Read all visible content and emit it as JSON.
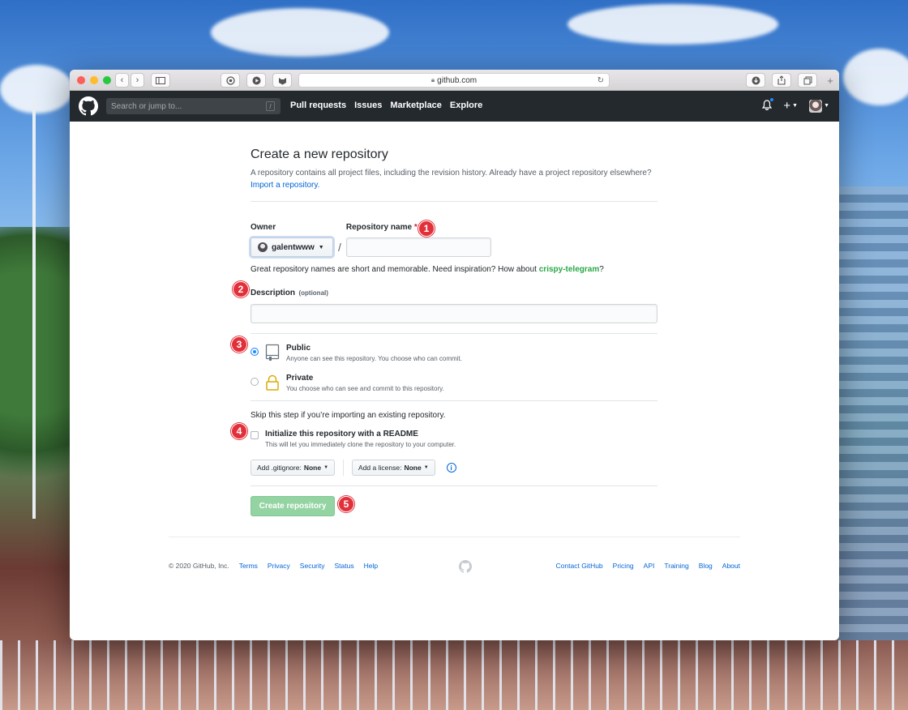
{
  "browser": {
    "url": "github.com"
  },
  "header": {
    "search_placeholder": "Search or jump to...",
    "search_shortcut": "/",
    "nav": [
      "Pull requests",
      "Issues",
      "Marketplace",
      "Explore"
    ],
    "plus_label": "+",
    "has_notification": true
  },
  "page": {
    "title": "Create a new repository",
    "desc_text": "A repository contains all project files, including the revision history. Already have a project repository elsewhere?",
    "import_link": "Import a repository."
  },
  "form": {
    "owner_label": "Owner",
    "owner_value": "galentwww",
    "repo_name_label": "Repository name",
    "required_marker": "*",
    "repo_name_value": "",
    "slash": "/",
    "hint_text": "Great repository names are short and memorable. Need inspiration? How about",
    "hint_suggestion": "crispy-telegram",
    "hint_suffix": "?",
    "description_label": "Description",
    "description_optional": "(optional)",
    "description_value": "",
    "visibility": [
      {
        "title": "Public",
        "desc": "Anyone can see this repository. You choose who can commit.",
        "checked": true
      },
      {
        "title": "Private",
        "desc": "You choose who can see and commit to this repository.",
        "checked": false
      }
    ],
    "skip_text": "Skip this step if you’re importing an existing repository.",
    "readme_label": "Initialize this repository with a README",
    "readme_desc": "This will let you immediately clone the repository to your computer.",
    "gitignore_label": "Add .gitignore:",
    "gitignore_value": "None",
    "license_label": "Add a license:",
    "license_value": "None",
    "info_glyph": "i",
    "submit_label": "Create repository"
  },
  "steps": [
    "1",
    "2",
    "3",
    "4",
    "5"
  ],
  "footer": {
    "copyright": "© 2020 GitHub, Inc.",
    "left_links": [
      "Terms",
      "Privacy",
      "Security",
      "Status",
      "Help"
    ],
    "right_links": [
      "Contact GitHub",
      "Pricing",
      "API",
      "Training",
      "Blog",
      "About"
    ]
  },
  "colors": {
    "header_bg": "#24292e",
    "link": "#0366d6",
    "primary_disabled": "#94d3a2",
    "step_badge": "#e2303a",
    "suggestion": "#28a745"
  }
}
